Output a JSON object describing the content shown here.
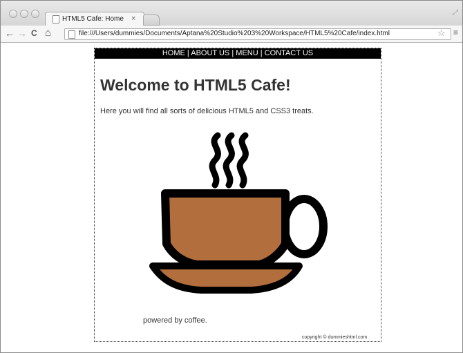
{
  "browser": {
    "tab_title": "HTML5 Cafe: Home",
    "tab_close": "×",
    "url": "file:///Users/dummies/Documents/Aptana%20Studio%203%20Workspace/HTML5%20Cafe/index.html",
    "back_icon": "←",
    "forward_icon": "→",
    "reload_icon": "C",
    "home_icon": "⌂",
    "star_icon": "☆",
    "menu_icon": "≡"
  },
  "nav": {
    "items": [
      "HOME",
      "ABOUT US",
      "MENU",
      "CONTACT US"
    ],
    "separator": " | "
  },
  "content": {
    "heading": "Welcome to HTML5 Cafe!",
    "intro": "Here you will find all sorts of delicious HTML5 and CSS3 treats.",
    "image": "coffee-cup",
    "powered": "powered by coffee.",
    "copyright": "copyright © dummieshtml.com"
  },
  "colors": {
    "coffee": "#b36e3d",
    "nav_bg": "#000000",
    "text": "#333333"
  }
}
